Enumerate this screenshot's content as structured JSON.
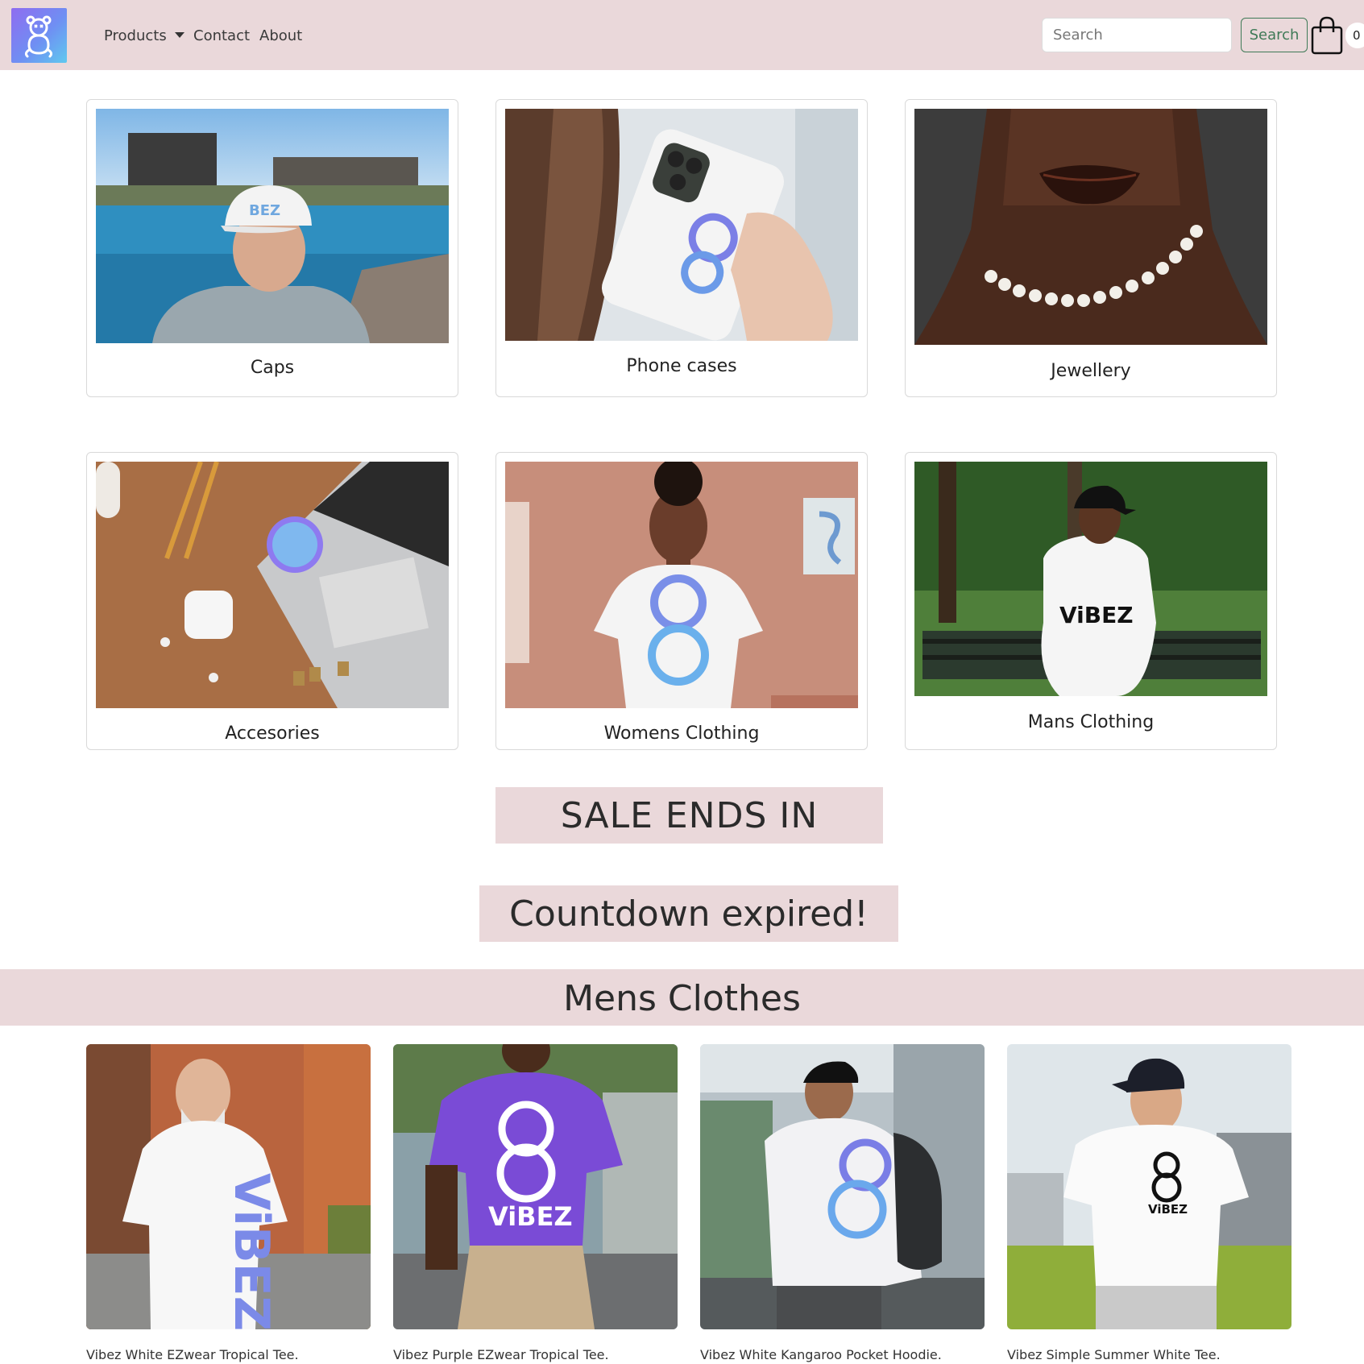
{
  "navbar": {
    "products_label": "Products",
    "contact_label": "Contact",
    "about_label": "About",
    "search_placeholder": "Search",
    "search_button_label": "Search",
    "cart_count": "0",
    "logo_icon": "teddy-bear-logo",
    "cart_icon": "shopping-bag-icon"
  },
  "categories": [
    {
      "label": "Caps"
    },
    {
      "label": "Phone cases"
    },
    {
      "label": "Jewellery"
    },
    {
      "label": "Accesories"
    },
    {
      "label": "Womens Clothing"
    },
    {
      "label": "Mans Clothing"
    }
  ],
  "sale": {
    "heading": "SALE ENDS IN",
    "countdown_text": "Countdown expired!"
  },
  "mens_section": {
    "title": "Mens Clothes",
    "products": [
      {
        "name": "Vibez White EZwear Tropical Tee."
      },
      {
        "name": "Vibez Purple EZwear Tropical Tee."
      },
      {
        "name": "Vibez White Kangaroo Pocket Hoodie."
      },
      {
        "name": "Vibez Simple Summer White Tee."
      }
    ]
  },
  "colors": {
    "navbar_bg": "#ead8da",
    "accent_green": "#3f7a57",
    "brand_purple": "#8f6cf0",
    "brand_blue": "#5fc9ef"
  }
}
